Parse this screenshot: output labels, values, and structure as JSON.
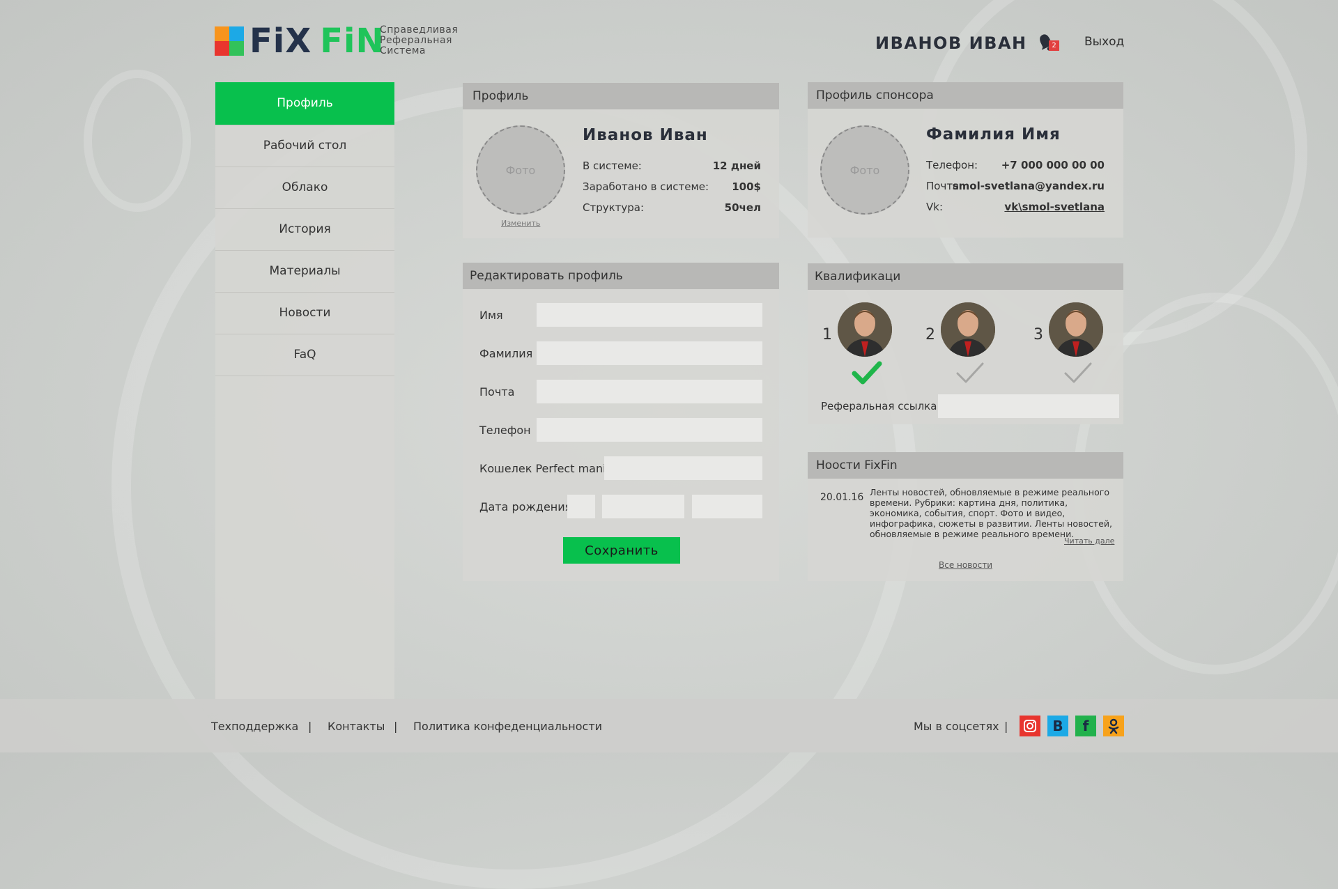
{
  "header": {
    "logo_fix": "FiX",
    "logo_fin": "FiN",
    "tagline": [
      "Справедливая",
      "Реферальная",
      "Система"
    ],
    "user_name": "ИВАНОВ ИВАН",
    "notifications_count": "2",
    "logout_label": "Выход"
  },
  "colors": {
    "accent_green": "#08c04d",
    "logo_orange": "#f7941d",
    "logo_blue": "#1ca9e6",
    "logo_green": "#32c25a",
    "logo_red": "#e8352e",
    "badge_red": "#e24040"
  },
  "sidebar": {
    "items": [
      {
        "label": "Профиль",
        "active": true
      },
      {
        "label": "Рабочий стол",
        "active": false
      },
      {
        "label": "Облако",
        "active": false
      },
      {
        "label": "История",
        "active": false
      },
      {
        "label": "Материалы",
        "active": false
      },
      {
        "label": "Новости",
        "active": false
      },
      {
        "label": "FaQ",
        "active": false
      }
    ]
  },
  "profile": {
    "title": "Профиль",
    "photo_placeholder": "Фото",
    "change_label": "Изменить",
    "name": "Иванов Иван",
    "rows": [
      {
        "label": "В системе:",
        "value": "12 дней"
      },
      {
        "label": "Заработано в системе:",
        "value": "100$"
      },
      {
        "label": "Структура:",
        "value": "50чел"
      }
    ]
  },
  "sponsor": {
    "title": "Профиль спонсора",
    "photo_placeholder": "Фото",
    "name": "Фамилия Имя",
    "rows": [
      {
        "label": "Телефон:",
        "value": "+7 000 000 00 00"
      },
      {
        "label": "Почта:",
        "value": "smol-svetlana@yandex.ru"
      },
      {
        "label": "Vk:",
        "value": "vk\\smol-svetlana"
      }
    ]
  },
  "edit_profile": {
    "title": "Редактировать профиль",
    "fields": [
      {
        "label": "Имя",
        "value": ""
      },
      {
        "label": "Фамилия",
        "value": ""
      },
      {
        "label": "Почта",
        "value": ""
      },
      {
        "label": "Телефон",
        "value": ""
      },
      {
        "label": "Кошелек Perfect mani",
        "value": ""
      }
    ],
    "birth_label": "Дата рождения",
    "save_label": "Сохранить"
  },
  "qualifications": {
    "title": "Квалификаци",
    "items": [
      {
        "number": "1",
        "achieved": true,
        "icon": "check-icon"
      },
      {
        "number": "2",
        "achieved": false,
        "icon": "check-icon"
      },
      {
        "number": "3",
        "achieved": false,
        "icon": "check-icon"
      }
    ],
    "referral_label": "Реферальная ссылка",
    "referral_value": ""
  },
  "news": {
    "title": "Ноости FixFin",
    "date": "20.01.16",
    "text": "Ленты новостей, обновляемые в режиме реального времени. Рубрики: картина дня, политика, экономика, события, спорт. Фото и видео, инфографика, сюжеты в развитии. Ленты новостей, обновляемые в режиме реального времени.",
    "read_more": "Читать дале",
    "all_news": "Все новости"
  },
  "footer": {
    "links": [
      "Техподдержка",
      "Контакты",
      "Политика конфеденциальности"
    ],
    "separator": "|",
    "social_label": "Мы в соцсетях",
    "socials": [
      {
        "name": "instagram-icon",
        "glyph": "",
        "color": "#e8352e"
      },
      {
        "name": "vk-icon",
        "glyph": "B",
        "color": "#1ca9e6"
      },
      {
        "name": "facebook-icon",
        "glyph": "f",
        "color": "#22b14c"
      },
      {
        "name": "odnoklassniki-icon",
        "glyph": "",
        "color": "#f7a21b"
      }
    ]
  }
}
